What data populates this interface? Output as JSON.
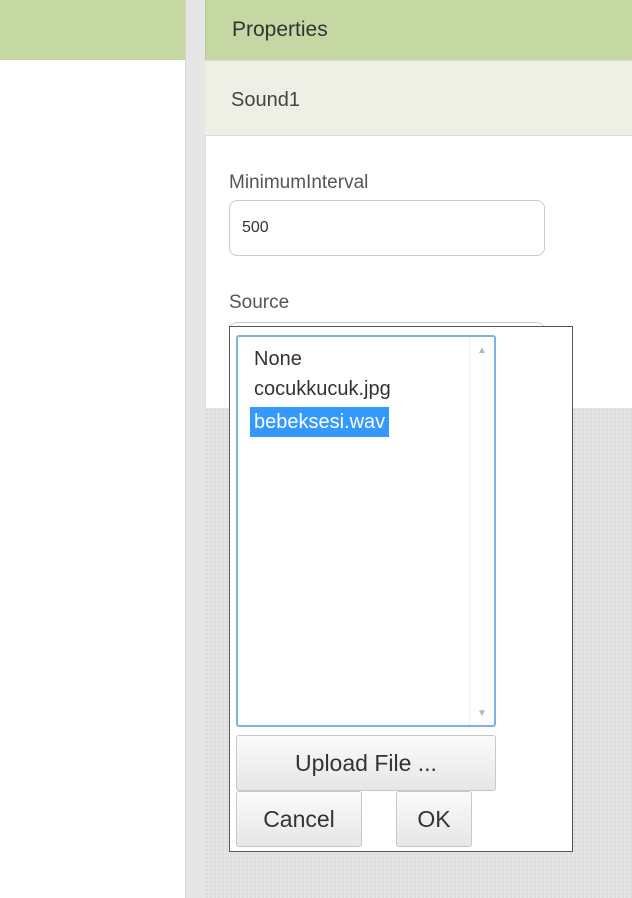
{
  "header": {
    "properties_title": "Properties"
  },
  "component": {
    "name": "Sound1"
  },
  "properties": {
    "minimum_interval": {
      "label": "MinimumInterval",
      "value": "500"
    },
    "source": {
      "label": "Source"
    }
  },
  "source_picker": {
    "items": [
      "None",
      "cocukkucuk.jpg",
      "bebeksesi.wav"
    ],
    "selected_item": "bebeksesi.wav",
    "upload_label": "Upload File ...",
    "cancel_label": "Cancel",
    "ok_label": "OK"
  },
  "colors": {
    "header_green": "#c5d8a4",
    "selection_blue": "#3399ff",
    "list_border": "#7fb0e3"
  }
}
